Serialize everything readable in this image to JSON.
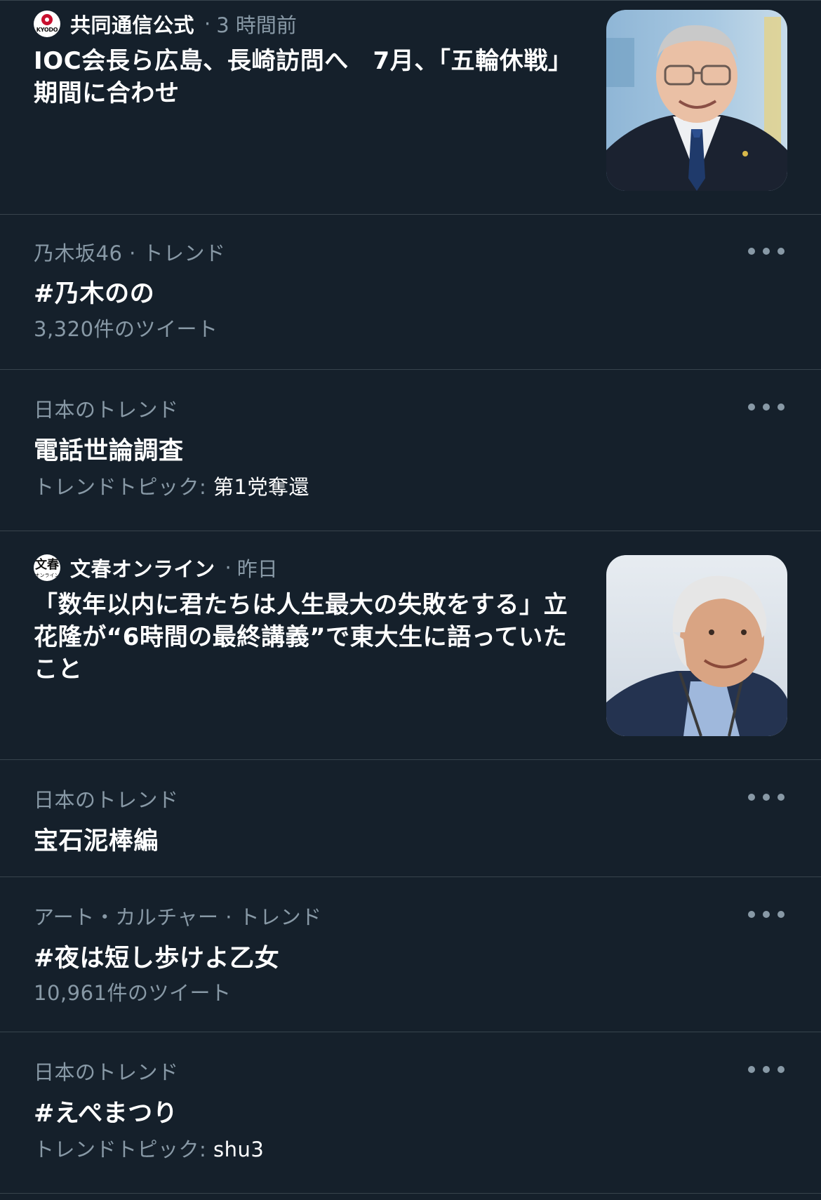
{
  "feed": {
    "items": [
      {
        "kind": "news",
        "source_name": "共同通信公式",
        "source_logo_text": "KYODO",
        "separator": "·",
        "time": "3 時間前",
        "title": "IOC会長ら広島、長崎訪問へ　7月、「五輪休戦」期間に合わせ",
        "thumbnail_icon": "ioc-president-photo"
      },
      {
        "kind": "trend",
        "context": "乃木坂46 · トレンド",
        "name": "#乃木のの",
        "meta": "3,320件のツイート"
      },
      {
        "kind": "trend",
        "context": "日本のトレンド",
        "name": "電話世論調査",
        "meta_prefix": "トレンドトピック: ",
        "meta_topic": "第1党奪還"
      },
      {
        "kind": "news",
        "source_name": "文春オンライン",
        "source_logo_text": "文春",
        "source_logo_subtext": "オンライン",
        "separator": "·",
        "time": "昨日",
        "title": "「数年以内に君たちは人生最大の失敗をする」立花隆が“6時間の最終講義”で東大生に語っていたこと",
        "thumbnail_icon": "tachibana-portrait-photo"
      },
      {
        "kind": "trend",
        "context": "日本のトレンド",
        "name": "宝石泥棒編"
      },
      {
        "kind": "trend",
        "context": "アート・カルチャー · トレンド",
        "name": "#夜は短し歩けよ乙女",
        "meta": "10,961件のツイート"
      },
      {
        "kind": "trend",
        "context": "日本のトレンド",
        "name": "#えぺまつり",
        "meta_prefix": "トレンドトピック: ",
        "meta_topic": "shu3"
      }
    ]
  },
  "icons": {
    "more": "more-horizontal-icon"
  },
  "colors": {
    "background": "#15202b",
    "divider": "#38444d",
    "secondary_text": "#8899a6",
    "primary_text": "#ffffff"
  }
}
